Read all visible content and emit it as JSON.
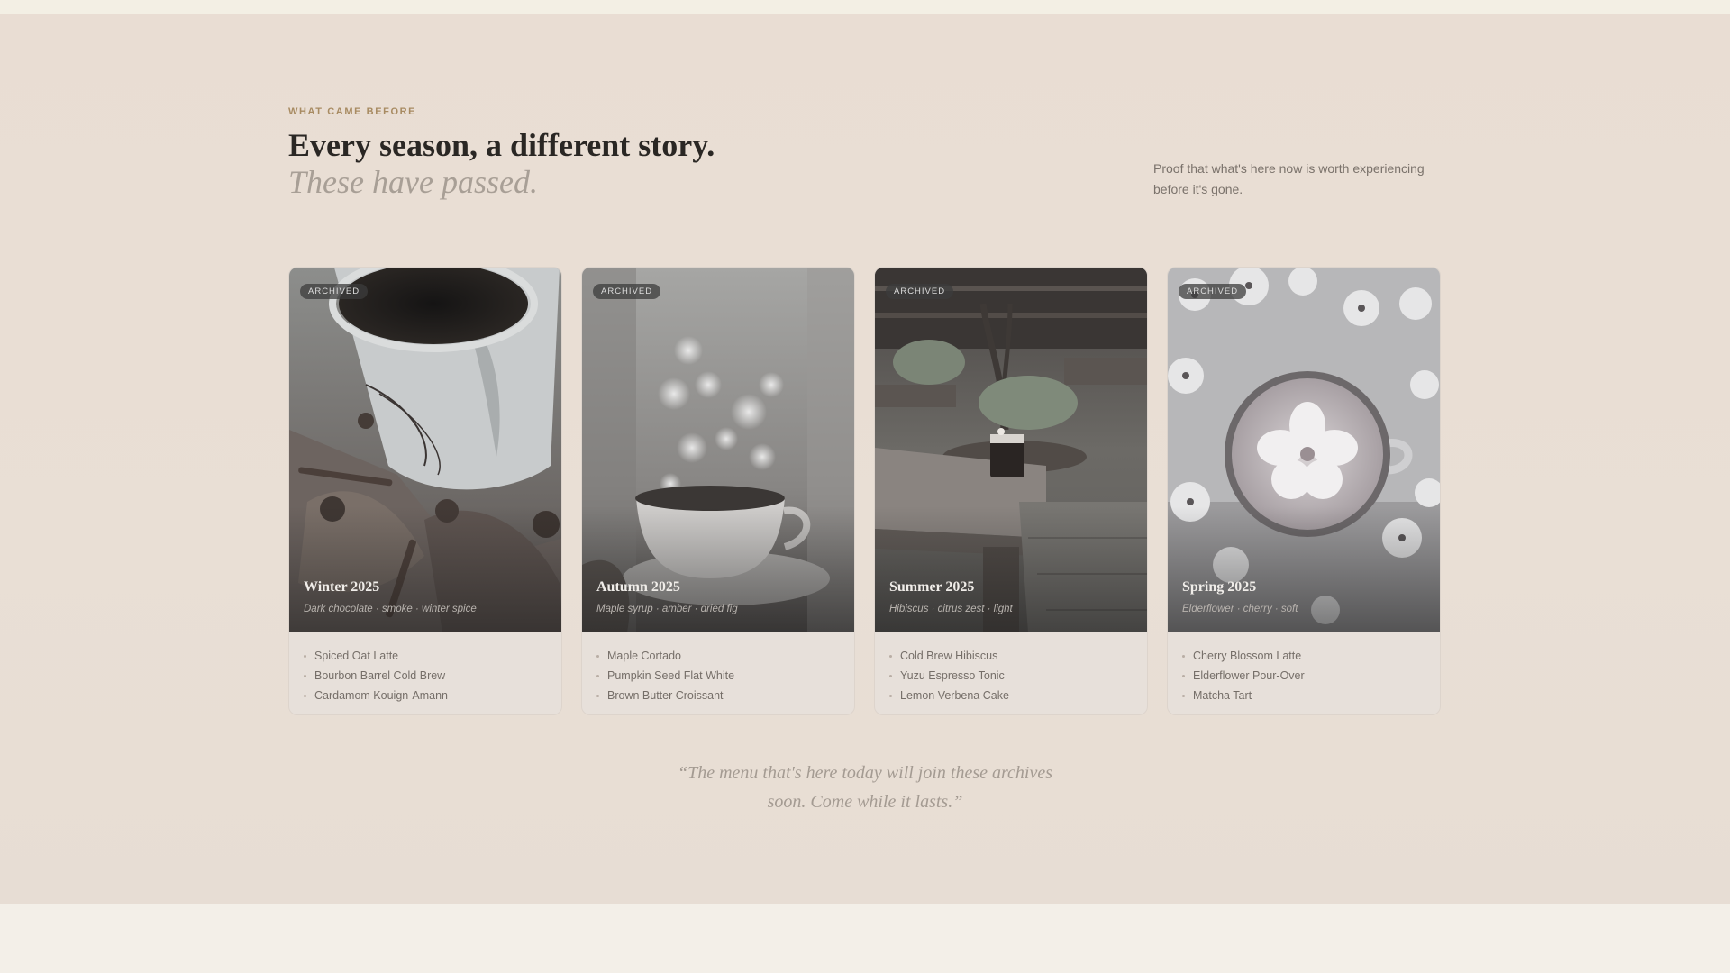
{
  "header": {
    "eyebrow": "WHAT CAME BEFORE",
    "title": "Every season, a different story.",
    "subtitle": "These have passed.",
    "intro": "Proof that what's here now is worth experiencing before it's gone."
  },
  "cards": [
    {
      "badge": "ARCHIVED",
      "season": "Winter 2025",
      "notes": "Dark chocolate · smoke · winter spice",
      "photo": "coffee-mug-with-leaves-and-pinecones",
      "items": [
        "Spiced Oat Latte",
        "Bourbon Barrel Cold Brew",
        "Cardamom Kouign-Amann"
      ]
    },
    {
      "badge": "ARCHIVED",
      "season": "Autumn 2025",
      "notes": "Maple syrup · amber · dried fig",
      "photo": "coffee-cup-with-bokeh-lights",
      "items": [
        "Maple Cortado",
        "Pumpkin Seed Flat White",
        "Brown Butter Croissant"
      ]
    },
    {
      "badge": "ARCHIVED",
      "season": "Summer 2025",
      "notes": "Hibiscus · citrus zest · light",
      "photo": "iced-drink-on-outdoor-table",
      "items": [
        "Cold Brew Hibiscus",
        "Yuzu Espresso Tonic",
        "Lemon Verbena Cake"
      ]
    },
    {
      "badge": "ARCHIVED",
      "season": "Spring 2025",
      "notes": "Elderflower · cherry · soft",
      "photo": "latte-art-among-flowers",
      "items": [
        "Cherry Blossom Latte",
        "Elderflower Pour-Over",
        "Matcha Tart"
      ]
    }
  ],
  "quote": "“The menu that's here today will join these archives soon. Come while it lasts.”",
  "colors": {
    "section_bg": "#e9ddd3",
    "eyebrow": "#a88b62",
    "subtitle": "#a89f96",
    "card_bg": "#e7e0da"
  }
}
